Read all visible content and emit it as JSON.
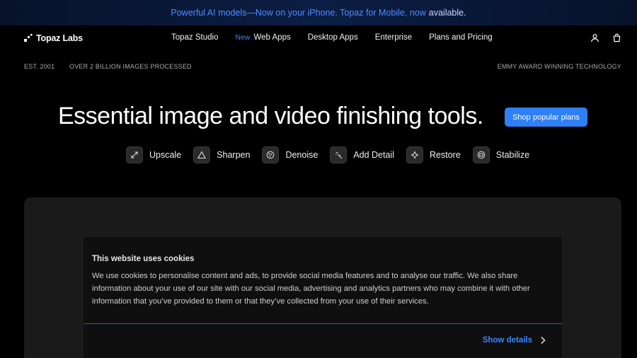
{
  "announcement": {
    "text": "Powerful AI models—Now on your iPhone. Topaz for Mobile, now",
    "strong": "available."
  },
  "nav": {
    "logo_text": "Topaz Labs",
    "links": [
      {
        "label": "Topaz Studio"
      },
      {
        "badge": "New",
        "label": "Web Apps"
      },
      {
        "label": "Desktop Apps"
      },
      {
        "label": "Enterprise"
      },
      {
        "label": "Plans and Pricing"
      }
    ],
    "icons": [
      "user-icon",
      "bag-icon"
    ]
  },
  "meta": {
    "est": "EST. 2001",
    "images": "OVER 2 BILLION IMAGES PROCESSED",
    "award": "EMMY AWARD WINNING TECHNOLOGY"
  },
  "hero": {
    "title": "Essential image and video finishing tools.",
    "cta": "Shop popular plans"
  },
  "tools": [
    {
      "label": "Upscale",
      "icon": "expand-arrows-icon"
    },
    {
      "label": "Sharpen",
      "icon": "triangle-icon"
    },
    {
      "label": "Denoise",
      "icon": "noise-circle-icon"
    },
    {
      "label": "Add Detail",
      "icon": "sparkle-wand-icon"
    },
    {
      "label": "Restore",
      "icon": "star-sparkle-icon"
    },
    {
      "label": "Stabilize",
      "icon": "stabilize-icon"
    }
  ],
  "cookie": {
    "title": "This website uses cookies",
    "body": "We use cookies to personalise content and ads, to provide social media features and to analyse our traffic. We also share information about your use of our site with our social media, advertising and analytics partners who may combine it with other information that you’ve provided to them or that they’ve collected from your use of their services.",
    "details_label": "Show details"
  },
  "colors": {
    "accent": "#2f7ff5",
    "link": "#3a86ff",
    "background": "#000000"
  }
}
